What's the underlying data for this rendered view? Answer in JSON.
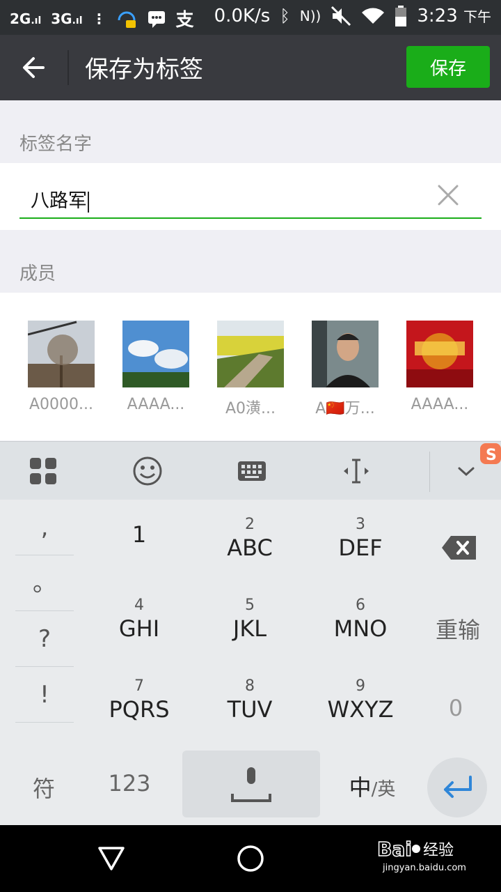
{
  "status_bar": {
    "net1": "2G",
    "net2": "3G",
    "speed": "0.0K/s",
    "time": "3:23",
    "ampm": "下午"
  },
  "header": {
    "title": "保存为标签",
    "save_label": "保存"
  },
  "tag_name": {
    "section_label": "标签名字",
    "value": "八路军"
  },
  "members": {
    "section_label": "成员",
    "items": [
      {
        "name": "A0000..."
      },
      {
        "name": "AAAA..."
      },
      {
        "name": "A0潢..."
      },
      {
        "name": "A🇨🇳万..."
      },
      {
        "name": "AAAA..."
      }
    ]
  },
  "keyboard": {
    "punct": [
      ",",
      "。",
      "?",
      "!"
    ],
    "keys": [
      {
        "num": "",
        "letters": "1"
      },
      {
        "num": "2",
        "letters": "ABC"
      },
      {
        "num": "3",
        "letters": "DEF"
      },
      {
        "num": "4",
        "letters": "GHI"
      },
      {
        "num": "5",
        "letters": "JKL"
      },
      {
        "num": "6",
        "letters": "MNO"
      },
      {
        "num": "7",
        "letters": "PQRS"
      },
      {
        "num": "8",
        "letters": "TUV"
      },
      {
        "num": "9",
        "letters": "WXYZ"
      }
    ],
    "reinput_label": "重输",
    "zero_label": "0",
    "symbol_label": "符",
    "num_label": "123",
    "lang_main": "中",
    "lang_alt": "/英"
  },
  "watermark": {
    "site": "jingyan.baidu.com",
    "brand": "经验"
  },
  "colors": {
    "accent": "#1aad19",
    "header_bg": "#393a3f"
  }
}
